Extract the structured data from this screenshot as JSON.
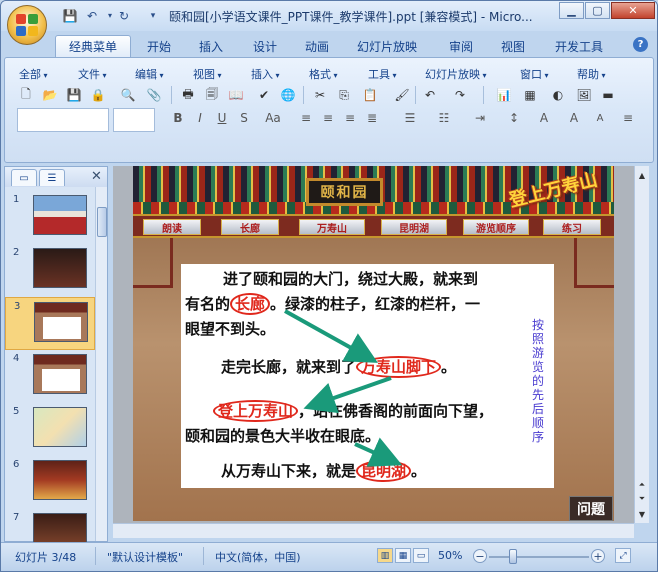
{
  "window": {
    "title": "颐和园[小学语文课件_PPT课件_教学课件].ppt [兼容模式] - Micro..."
  },
  "tabs": [
    "经典菜单",
    "开始",
    "插入",
    "设计",
    "动画",
    "幻灯片放映",
    "审阅",
    "视图",
    "开发工具"
  ],
  "menus": [
    "全部",
    "文件",
    "编辑",
    "视图",
    "插入",
    "格式",
    "工具",
    "幻灯片放映",
    "窗口",
    "帮助"
  ],
  "slide_pane": {
    "numbers": [
      "1",
      "2",
      "3",
      "4",
      "5",
      "6",
      "7"
    ],
    "selected": "3"
  },
  "slide": {
    "plaque": "颐和园",
    "title": "登上万寿山",
    "nav": [
      "朗读",
      "长廊",
      "万寿山",
      "昆明湖",
      "游览顺序",
      "练习"
    ],
    "p1_line1": "进了颐和园的大门，绕过大殿，就来到",
    "p1_line2_pre": "有名的",
    "p1_line2_hl": "长廊",
    "p1_line2_post": "。绿漆的柱子，红漆的栏杆，一",
    "p1_line3": "眼望不到头。",
    "p2_pre": "走完长廊，就来到了",
    "p2_hl": "万寿山脚下",
    "p2_post": "。",
    "p3_hl": "登上万寿山",
    "p3_post": "，站在佛香阁的前面向下望，",
    "p3_line2": "颐和园的景色大半收在眼底。",
    "p4_pre": "从万寿山下来，就是",
    "p4_hl": "昆明湖",
    "p4_post": "。",
    "side_note": "按照游览的先后顺序",
    "question_button": "问题"
  },
  "status": {
    "slide_counter": "幻灯片 3/48",
    "theme": "\"默认设计模板\"",
    "language": "中文(简体，中国)",
    "zoom": "50%"
  },
  "colors": {
    "highlight": "#e0281c",
    "arrow": "#1a9a7a",
    "side_note": "#4a3cd0"
  }
}
